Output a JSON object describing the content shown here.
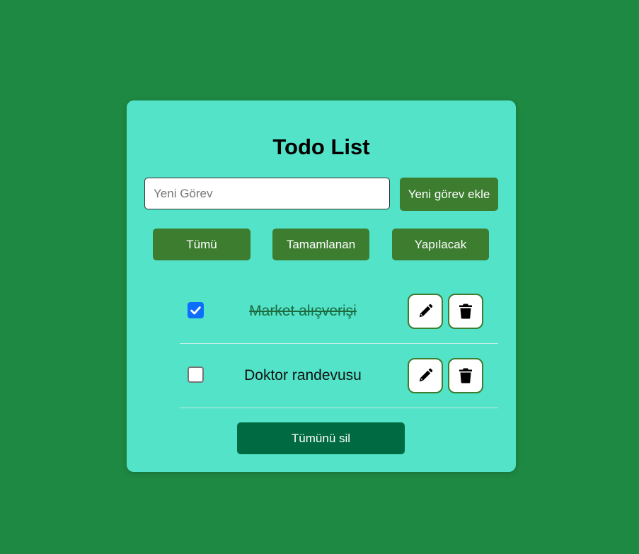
{
  "app": {
    "title": "Todo List"
  },
  "input": {
    "placeholder": "Yeni Görev",
    "value": "",
    "add_label": "Yeni görev ekle"
  },
  "filters": [
    {
      "label": "Tümü"
    },
    {
      "label": "Tamamlanan"
    },
    {
      "label": "Yapılacak"
    }
  ],
  "todos": [
    {
      "text": "Market alışverişi",
      "completed": true,
      "edit_icon": "pencil-icon",
      "delete_icon": "trash-icon"
    },
    {
      "text": "Doktor randevusu",
      "completed": false,
      "edit_icon": "pencil-icon",
      "delete_icon": "trash-icon"
    }
  ],
  "footer": {
    "clear_all_label": "Tümünü sil"
  },
  "colors": {
    "background": "#1e8943",
    "card": "#52e3c8",
    "button": "#3c7d2f",
    "clear_button": "#006b42",
    "checkbox_checked": "#0d6efd"
  }
}
